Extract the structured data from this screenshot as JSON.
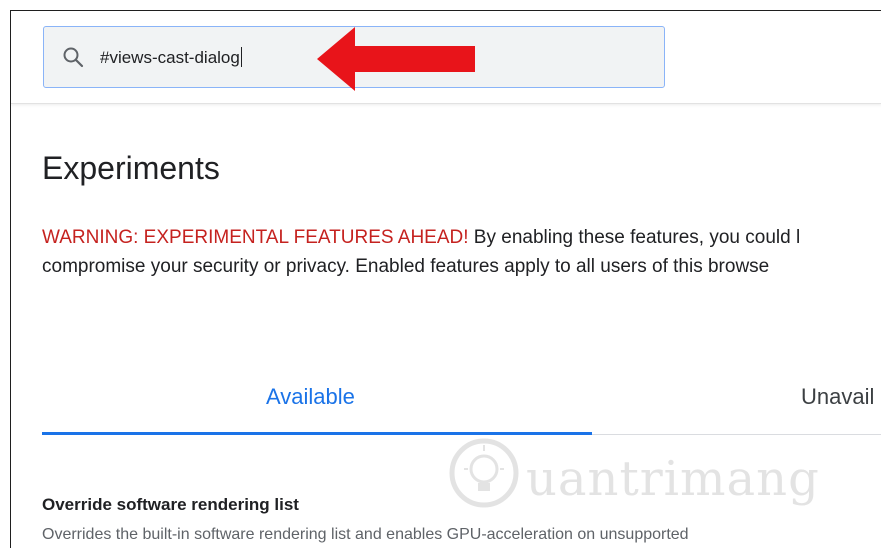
{
  "search": {
    "value": "#views-cast-dialog"
  },
  "page": {
    "title": "Experiments",
    "warning_strong": "WARNING: EXPERIMENTAL FEATURES AHEAD!",
    "warning_line1_rest": " By enabling these features, you could l",
    "warning_line2": "compromise your security or privacy. Enabled features apply to all users of this browse"
  },
  "tabs": {
    "available": "Available",
    "unavailable": "Unavail"
  },
  "flag": {
    "title": "Override software rendering list",
    "description": "Overrides the built-in software rendering list and enables GPU-acceleration on unsupported"
  },
  "watermark": {
    "text": "uantrimang"
  },
  "colors": {
    "accent": "#1a73e8",
    "warning": "#c5221f",
    "arrow": "#e8141a"
  }
}
